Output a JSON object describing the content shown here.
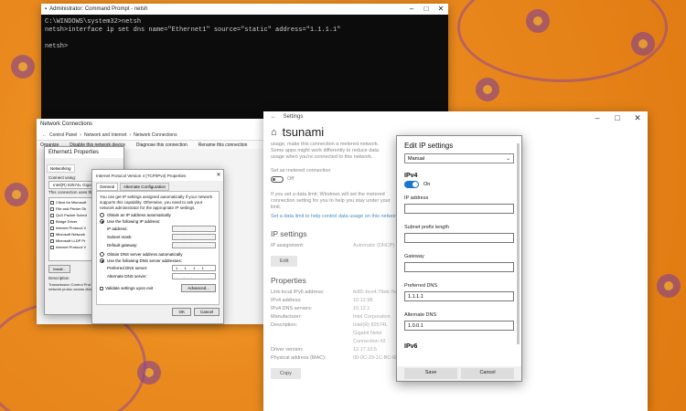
{
  "cmd": {
    "title": "Administrator: Command Prompt - netsh",
    "lines": [
      "C:\\WINDOWS\\system32>netsh",
      "netsh>interface ip set dns name=\"Ethernet1\" source=\"static\" address=\"1.1.1.1\"",
      "",
      "netsh>"
    ]
  },
  "netconn": {
    "title": "Network Connections",
    "breadcrumb": [
      "Control Panel",
      "Network and Internet",
      "Network Connections"
    ],
    "commands": [
      "Organize",
      "Disable this network device",
      "Diagnose this connection",
      "Rename this connection"
    ]
  },
  "ethprops": {
    "title": "Ethernet1 Properties",
    "tab": "Networking",
    "connect_using": "Connect using:",
    "adapter": "Intel(R) 82574L Gigabit",
    "uses": "This connection uses the fo",
    "items": [
      "Client for Microsoft",
      "File and Printer Sh",
      "QoS Packet Sched",
      "Bridge Driver",
      "Internet Protocol V",
      "Microsoft Network",
      "Microsoft LLDP Pr",
      "Internet Protocol V"
    ],
    "install": "Install...",
    "description_label": "Description",
    "description": "Transmission Control Prot wide area network protoc across diverse interconn"
  },
  "ipv4": {
    "title": "Internet Protocol Version 4 (TCP/IPv4) Properties",
    "tabs": [
      "General",
      "Alternate Configuration"
    ],
    "intro": "You can get IP settings assigned automatically if your network supports this capability. Otherwise, you need to ask your network administrator for the appropriate IP settings.",
    "auto_ip": "Obtain an IP address automatically",
    "use_ip": "Use the following IP address:",
    "ip_label": "IP address:",
    "mask_label": "Subnet mask:",
    "gw_label": "Default gateway:",
    "auto_dns": "Obtain DNS server address automatically",
    "use_dns": "Use the following DNS server addresses:",
    "pref_dns_label": "Preferred DNS server:",
    "pref_dns": "1 . 1 . 1 . 1",
    "alt_dns_label": "Alternate DNS server:",
    "validate": "Validate settings upon exit",
    "advanced": "Advanced...",
    "ok": "OK",
    "cancel": "Cancel"
  },
  "settings": {
    "title": "Settings",
    "network": "tsunami",
    "metered_text": "usage, make this connection a metered network. Some apps might work differently to reduce data usage when you're connected to this network.",
    "metered_label": "Set as metered connection",
    "metered_state": "Off",
    "limit_text": "If you set a data limit, Windows will set the metered connection setting for you to help you stay under your limit.",
    "limit_link": "Set a data limit to help control data usage on this network",
    "ip_settings_heading": "IP settings",
    "ip_assignment_label": "IP assignment:",
    "ip_assignment": "Automatic (DHCP)",
    "edit": "Edit",
    "properties_heading": "Properties",
    "props": [
      {
        "k": "Link-local IPv6 address:",
        "v": "fe80::bce4:79eb:7eab:4f70%5"
      },
      {
        "k": "IPv4 address:",
        "v": "10.12.98"
      },
      {
        "k": "IPv4 DNS servers:",
        "v": "10.12.1"
      },
      {
        "k": "Manufacturer:",
        "v": "Intel Corporation"
      },
      {
        "k": "Description:",
        "v": "Intel(R) 82574L Gigabit Netw Connection #2"
      },
      {
        "k": "Driver version:",
        "v": "12.17.10.5"
      },
      {
        "k": "Physical address (MAC):",
        "v": "00-0C-29-1C-BC-68"
      }
    ],
    "copy": "Copy"
  },
  "editip": {
    "title": "Edit IP settings",
    "mode": "Manual",
    "ipv4_heading": "IPv4",
    "ipv4_state": "On",
    "ip_label": "IP address",
    "ip": "",
    "prefix_label": "Subnet prefix length",
    "prefix": "",
    "gw_label": "Gateway",
    "gw": "",
    "pref_dns_label": "Preferred DNS",
    "pref_dns": "1.1.1.1",
    "alt_dns_label": "Alternate DNS",
    "alt_dns": "1.0.0.1",
    "ipv6_heading": "IPv6",
    "save": "Save",
    "cancel": "Cancel"
  },
  "icons": [
    "cmd-icon",
    "minimize-icon",
    "maximize-icon",
    "close-icon",
    "back-arrow-icon",
    "chevron-down-icon"
  ],
  "colors": {
    "accent": "#1976d2",
    "background": "#ea8a1e",
    "flower": "#7a3a9a"
  }
}
